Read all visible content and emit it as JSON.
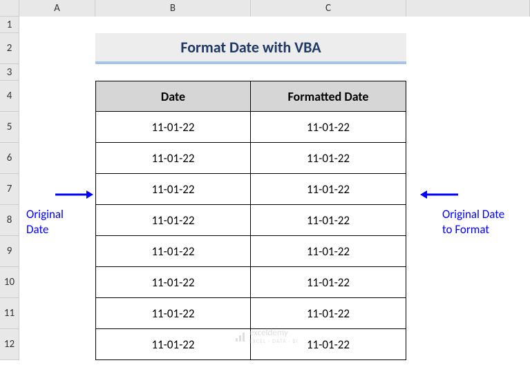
{
  "columns": [
    "A",
    "B",
    "C"
  ],
  "rows": [
    "1",
    "2",
    "3",
    "4",
    "5",
    "6",
    "7",
    "8",
    "9",
    "10",
    "11",
    "12"
  ],
  "title": "Format Date with VBA",
  "table": {
    "headers": [
      "Date",
      "Formatted Date"
    ],
    "rows": [
      [
        "11-01-22",
        "11-01-22"
      ],
      [
        "11-01-22",
        "11-01-22"
      ],
      [
        "11-01-22",
        "11-01-22"
      ],
      [
        "11-01-22",
        "11-01-22"
      ],
      [
        "11-01-22",
        "11-01-22"
      ],
      [
        "11-01-22",
        "11-01-22"
      ],
      [
        "11-01-22",
        "11-01-22"
      ],
      [
        "11-01-22",
        "11-01-22"
      ]
    ]
  },
  "annotations": {
    "left_line1": "Original",
    "left_line2": "Date",
    "right_line1": "Original Date",
    "right_line2": "to Format"
  },
  "watermark": {
    "main": "exceldemy",
    "sub": "EXCEL · DATA · BI"
  }
}
